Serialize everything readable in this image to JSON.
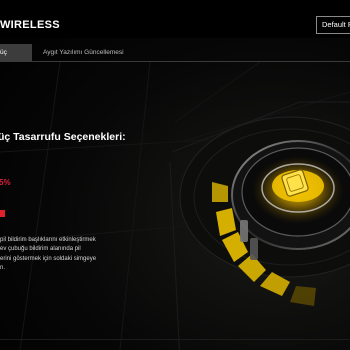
{
  "header": {
    "device_name": "WIRELESS",
    "profile_button": "Default P"
  },
  "tabs": [
    {
      "label": "üç",
      "active": true
    },
    {
      "label": "Aygıt Yazılımı Güncellemesi",
      "active": false
    }
  ],
  "main": {
    "section_title": "üç Tasarrufu Seçenekleri:",
    "percent_value": "5%",
    "description_lines": [
      "pil bildirim başlıklarını etkinleştirmek",
      "ev çubuğu bildirim alanında pil",
      "erini göstermek için soldaki simgeye",
      "n."
    ]
  },
  "colors": {
    "accent_red": "#e1202e",
    "accent_yellow": "#f2c200",
    "background": "#000000"
  },
  "icons": {
    "device_hero": "mouse-dock-icon"
  }
}
